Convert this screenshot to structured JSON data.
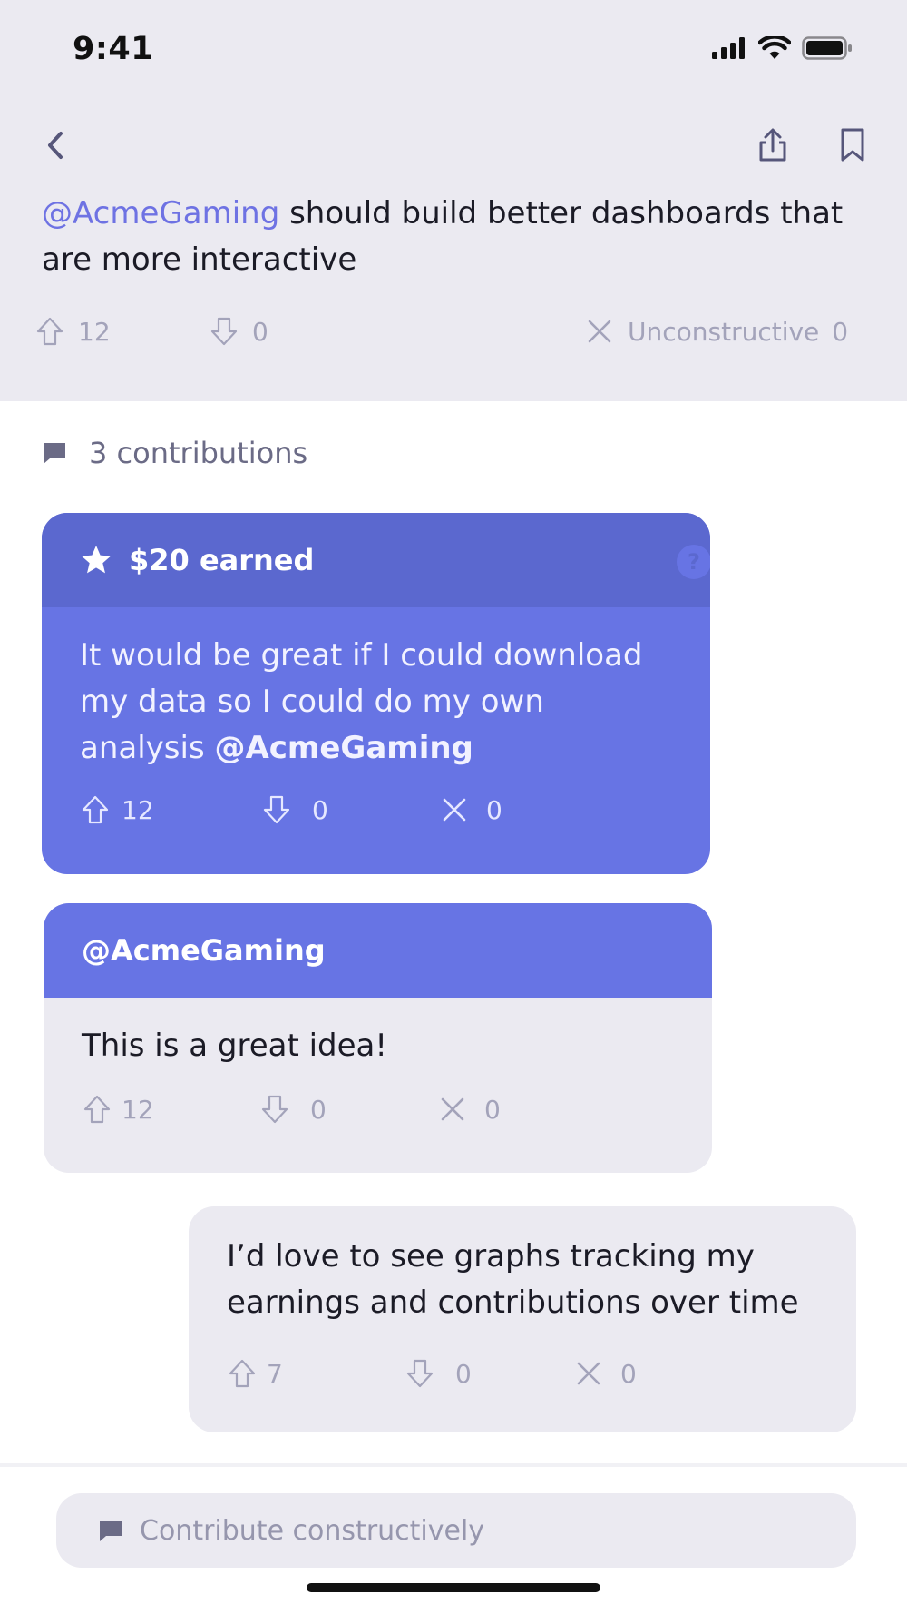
{
  "status_bar": {
    "time": "9:41"
  },
  "post": {
    "mention": "@AcmeGaming",
    "title_rest": " should build better dashboards that are more interactive",
    "upvotes": "12",
    "downvotes": "0",
    "unconstructive_label": "Unconstructive",
    "unconstructive_count": "0"
  },
  "contributions": {
    "count_label": "3 contributions",
    "items": [
      {
        "header": "$20 earned",
        "help_icon": "?",
        "text": "It would be great if I could download my data so I could do my own analysis ",
        "mention": "@AcmeGaming",
        "upvotes": "12",
        "downvotes": "0",
        "unconstructive": "0"
      },
      {
        "header": "@AcmeGaming",
        "text": "This is a great idea!",
        "upvotes": "12",
        "downvotes": "0",
        "unconstructive": "0"
      },
      {
        "text": "I’d love to see graphs tracking my earnings and contributions over time",
        "upvotes": "7",
        "downvotes": "0",
        "unconstructive": "0"
      }
    ]
  },
  "composer": {
    "placeholder": "Contribute constructively"
  },
  "colors": {
    "accent": "#6774e4",
    "accent_dark": "#5b68cf",
    "mention": "#6e72e3",
    "surface": "#ebeaf1",
    "muted": "#a3a3ba"
  },
  "icons": [
    "signal-icon",
    "wifi-icon",
    "battery-icon",
    "back-icon",
    "share-icon",
    "bookmark-icon",
    "upvote-icon",
    "downvote-icon",
    "close-icon",
    "comment-icon",
    "star-icon",
    "help-icon"
  ]
}
